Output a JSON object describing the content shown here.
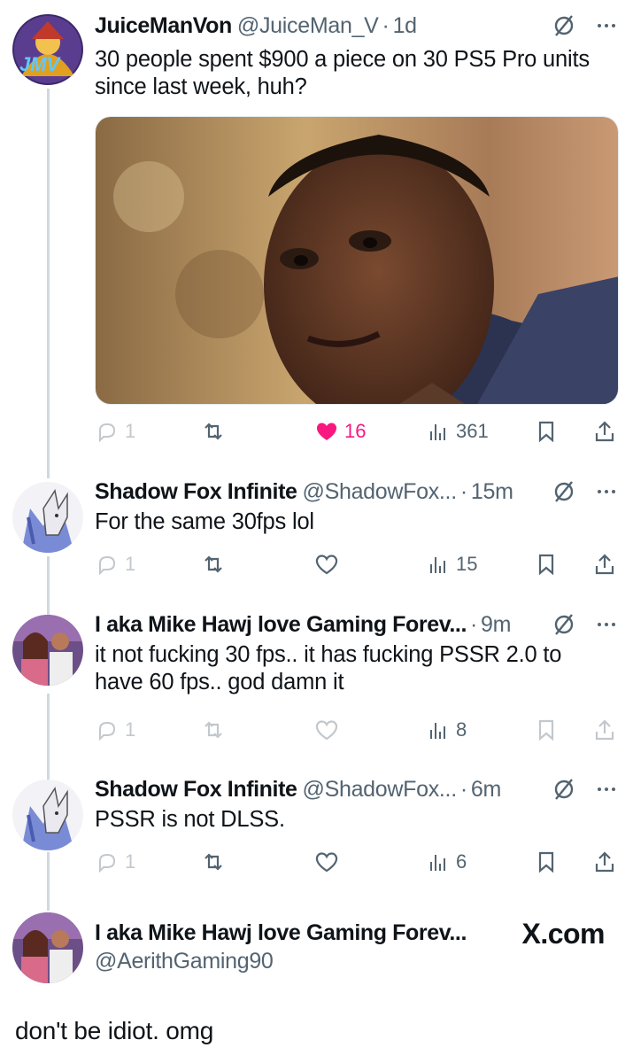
{
  "posts": [
    {
      "display_name": "JuiceManVon",
      "handle": "@JuiceMan_V",
      "separator": "·",
      "time": "1d",
      "text": "30 people spent $900 a piece on 30 PS5 Pro units since last week, huh?",
      "avatar_text": "JMV",
      "metrics": {
        "replies": "1",
        "likes": "16",
        "views": "361"
      }
    },
    {
      "display_name": "Shadow Fox Infinite",
      "handle": "@ShadowFox...",
      "separator": "·",
      "time": "15m",
      "text": "For the same 30fps lol",
      "metrics": {
        "replies": "1",
        "views": "15"
      }
    },
    {
      "display_name": "I aka Mike Hawj love Gaming Forev...",
      "separator": "·",
      "time": "9m",
      "text": "it not fucking 30 fps.. it has fucking PSSR 2.0 to have 60 fps.. god damn it",
      "metrics": {
        "replies": "1",
        "views": "8"
      }
    },
    {
      "display_name": "Shadow Fox Infinite",
      "handle": "@ShadowFox...",
      "separator": "·",
      "time": "6m",
      "text": "PSSR is not DLSS.",
      "metrics": {
        "replies": "1",
        "views": "6"
      }
    }
  ],
  "focused_post": {
    "display_name": "I aka Mike Hawj love Gaming Forev...",
    "handle": "@AerithGaming90",
    "text": "don't be idiot. omg"
  },
  "branding": {
    "site": "X.com"
  },
  "icons": [
    "reply-icon",
    "repost-icon",
    "like-icon",
    "views-icon",
    "bookmark-icon",
    "share-icon",
    "grok-icon",
    "more-icon"
  ],
  "colors": {
    "like_active": "#f91880",
    "secondary_text": "#536471",
    "thread_line": "#cfd9de"
  }
}
